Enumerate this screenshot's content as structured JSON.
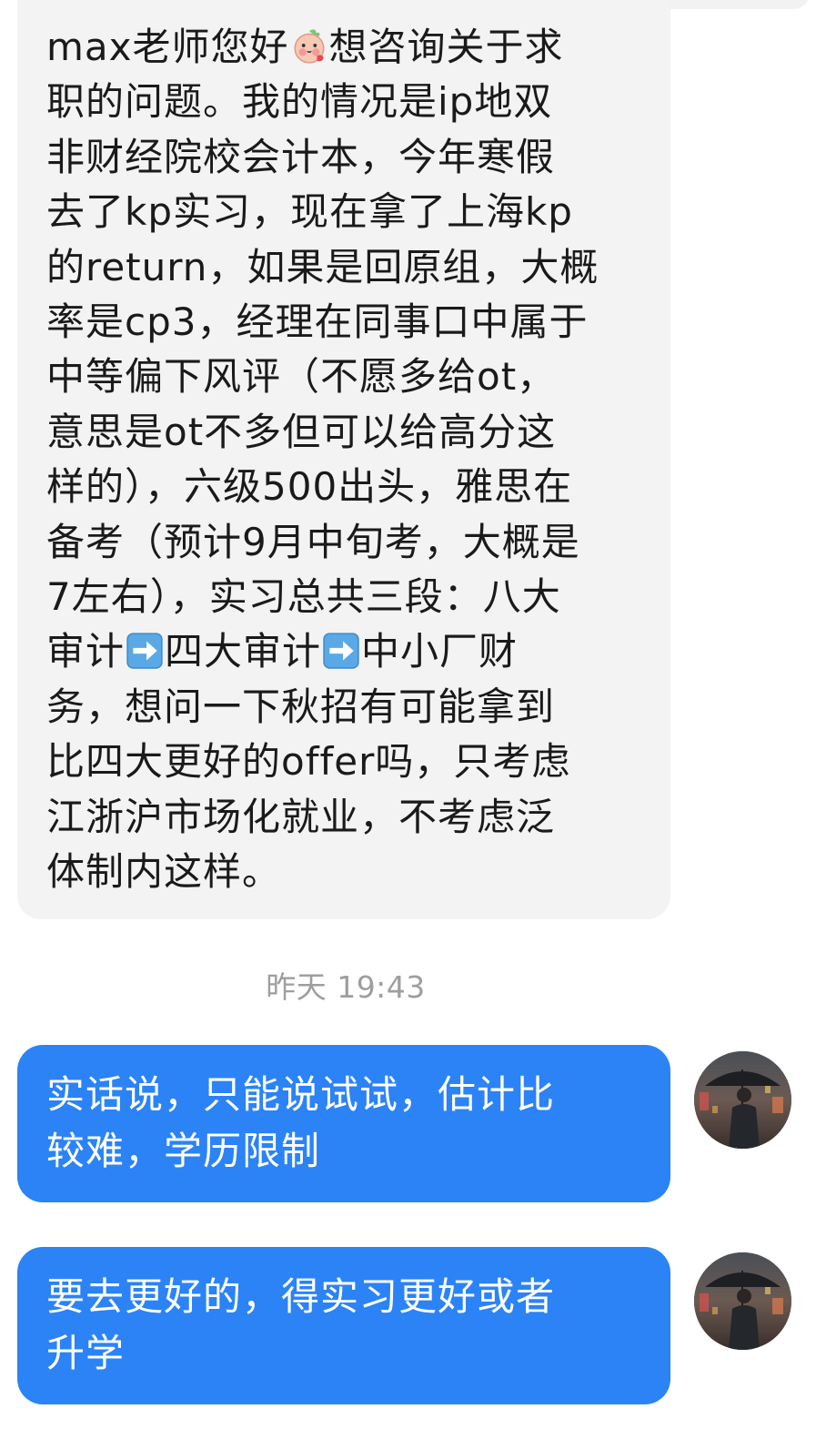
{
  "incoming_message": {
    "lines": [
      "max老师您好",
      "想咨询关于求",
      "职的问题。我的情况是ip地双",
      "非财经院校会计本，今年寒假",
      "去了kp实习，现在拿了上海kp",
      "的return，如果是回原组，大概",
      "率是cp3，经理在同事口中属于",
      "中等偏下风评（不愿多给ot，",
      "意思是ot不多但可以给高分这",
      "样的），六级500出头，雅思在",
      "备考（预计9月中旬考，大概是",
      "7左右），实习总共三段：八大",
      "审计",
      "四大审计",
      "中小厂财",
      "务，想问一下秋招有可能拿到",
      "比四大更好的offer吗，只考虑",
      "江浙沪市场化就业，不考虑泛",
      "体制内这样。"
    ],
    "emoji_icon": "blushing-peach-emoji",
    "arrow_icon": "right-arrow-emoji"
  },
  "timestamp": "昨天 19:43",
  "outgoing_messages": [
    {
      "line1": "实话说，只能说试试，估计比",
      "line2": "较难，学历限制"
    },
    {
      "line1": "要去更好的，得实习更好或者",
      "line2": "升学"
    }
  ],
  "colors": {
    "incoming_bg": "#f3f3f3",
    "outgoing_bg": "#2b83f6",
    "timestamp": "#9e9e9e"
  },
  "avatar_icon": "man-with-umbrella-avatar"
}
